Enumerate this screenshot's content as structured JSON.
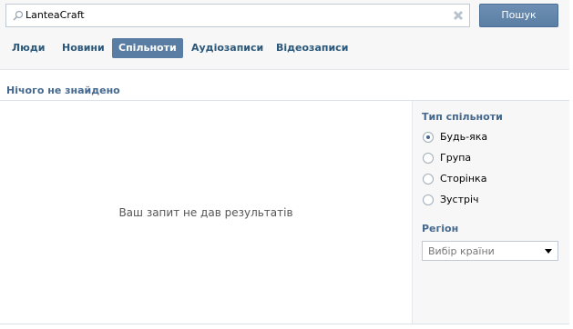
{
  "search": {
    "value": "LanteaCraft",
    "button_label": "Пошук"
  },
  "tabs": [
    {
      "label": "Люди",
      "active": false
    },
    {
      "label": "Новини",
      "active": false
    },
    {
      "label": "Спільноти",
      "active": true
    },
    {
      "label": "Аудіозаписи",
      "active": false
    },
    {
      "label": "Відеозаписи",
      "active": false
    }
  ],
  "results": {
    "header": "Нічого не знайдено",
    "empty_message": "Ваш запит не дав результатів"
  },
  "filters": {
    "community_type_title": "Тип спільноти",
    "community_types": [
      {
        "label": "Будь-яка",
        "checked": true
      },
      {
        "label": "Група",
        "checked": false
      },
      {
        "label": "Сторінка",
        "checked": false
      },
      {
        "label": "Зустріч",
        "checked": false
      }
    ],
    "region_title": "Регіон",
    "region_select": "Вибір країни"
  },
  "colors": {
    "accent": "#597da3",
    "link": "#2b587a",
    "header_text": "#45688e"
  }
}
